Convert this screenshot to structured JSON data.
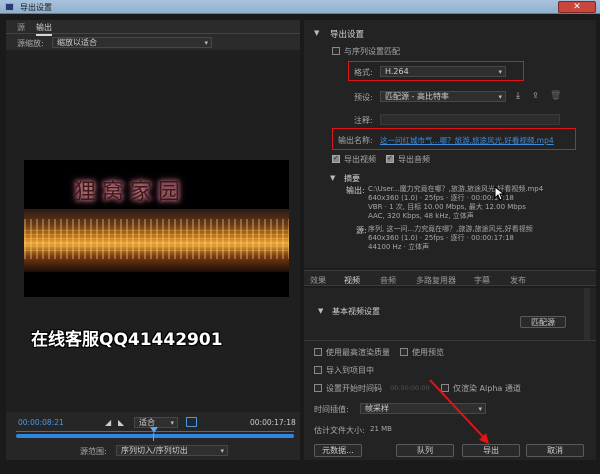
{
  "window": {
    "title": "导出设置",
    "close": "✕"
  },
  "left": {
    "tabs": [
      "源",
      "输出"
    ],
    "source_scaling_label": "源缩放:",
    "source_scaling_value": "缩放以适合",
    "preview_title": "狸窝家园",
    "watermark": "在线客服QQ41442901",
    "timecode_in": "00:00:08:21",
    "timecode_out": "00:00:17:18",
    "fit_value": "适合",
    "range_label": "源范围:",
    "range_value": "序列切入/序列切出"
  },
  "right": {
    "section_title": "导出设置",
    "match_sequence": "与序列设置匹配",
    "format_label": "格式:",
    "format_value": "H.264",
    "preset_label": "预设:",
    "preset_value": "匹配源 - 高比特率",
    "comment_label": "注释:",
    "output_name_label": "输出名称:",
    "output_name_value": "这一问红城市气...哪？旅游,旅途风光,好看视频.mp4",
    "export_video": "导出视频",
    "export_audio": "导出音频",
    "summary_title": "摘要",
    "output_label": "输出:",
    "output_lines": [
      "C:\\User...魔力究竟在哪？,旅游,旅途风光,好看视频.mp4",
      "640x360 (1.0) · 25fps · 逐行 · 00:00:17:18",
      "VBR · 1 次, 目标 10.00 Mbps, 最大 12.00 Mbps",
      "AAC, 320 Kbps, 48 kHz, 立体声"
    ],
    "source_label": "源:",
    "source_lines": [
      "序列, 这一问...力究竟在哪？,旅游,旅途风光,好看视频",
      "640x360 (1.0) · 25fps · 逐行 · 00:00:17:18",
      "44100 Hz · 立体声"
    ],
    "tabs": [
      "效果",
      "视频",
      "音频",
      "多路复用器",
      "字幕",
      "发布"
    ],
    "basic_video_title": "基本视频设置",
    "match_source_btn": "匹配源",
    "opt_max_render": "使用最高渲染质量",
    "opt_preview": "使用预览",
    "opt_import_project": "导入到项目中",
    "opt_start_timecode": "设置开始时间码",
    "opt_start_timecode_val": "00:00:00:00",
    "opt_alpha": "仅渲染 Alpha 通道",
    "interp_label": "时间插值:",
    "interp_value": "帧采样",
    "filesize_label": "估计文件大小:",
    "filesize_value": "21 MB",
    "btn_metadata": "元数据...",
    "btn_queue": "队列",
    "btn_export": "导出",
    "btn_cancel": "取消"
  },
  "colors": {
    "accent": "#3a8de0",
    "highlight": "#e01515",
    "watermark": "#ffffff"
  }
}
